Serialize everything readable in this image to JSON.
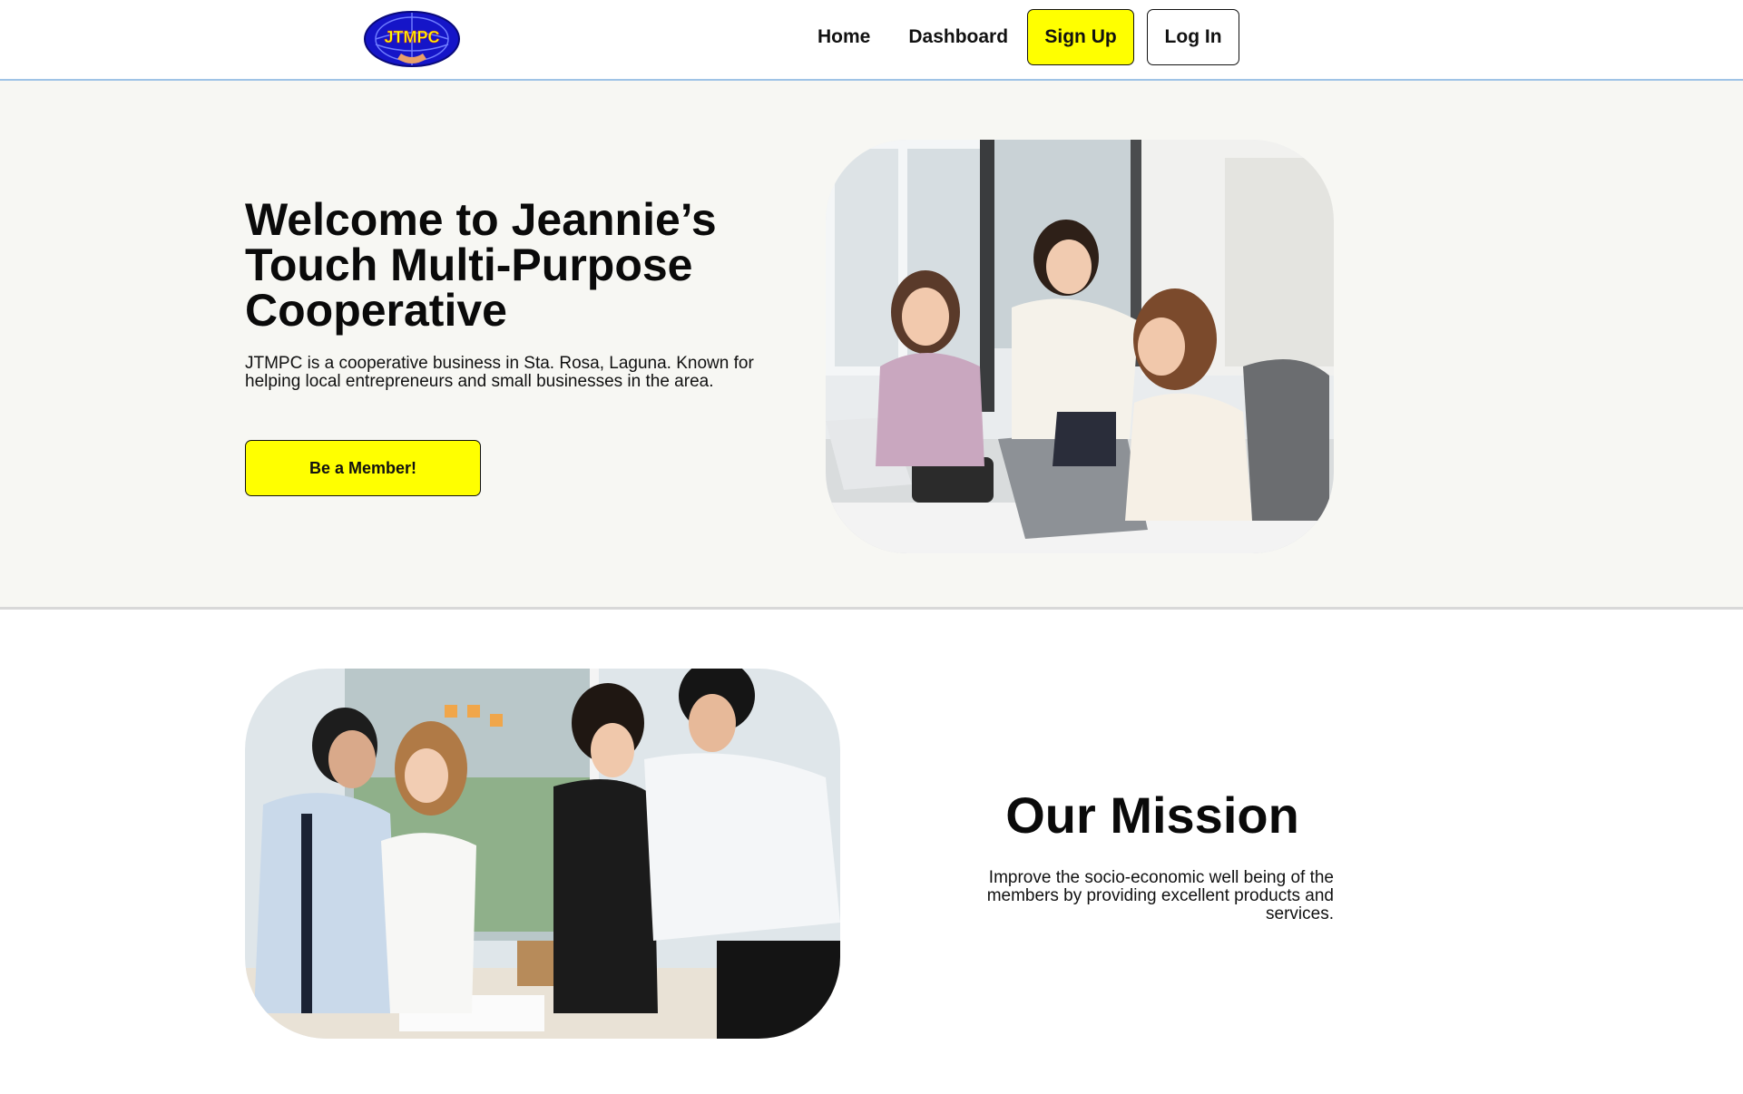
{
  "header": {
    "logo_text": "JTMPC",
    "nav": {
      "home": "Home",
      "dashboard": "Dashboard",
      "sign_up": "Sign Up",
      "log_in": "Log In"
    }
  },
  "hero": {
    "title": "Welcome to Jeannie’s Touch Multi-Purpose Cooperative",
    "description": "JTMPC is a cooperative business in Sta. Rosa, Laguna. Known for helping local entrepreneurs and small businesses in the area.",
    "cta": "Be a Member!"
  },
  "mission": {
    "title": "Our Mission",
    "text": "Improve the socio-economic well being of the members by providing excellent products and services."
  },
  "colors": {
    "accent": "#ffff00",
    "hero_bg": "#f7f7f3",
    "logo_blue": "#1515c8"
  }
}
